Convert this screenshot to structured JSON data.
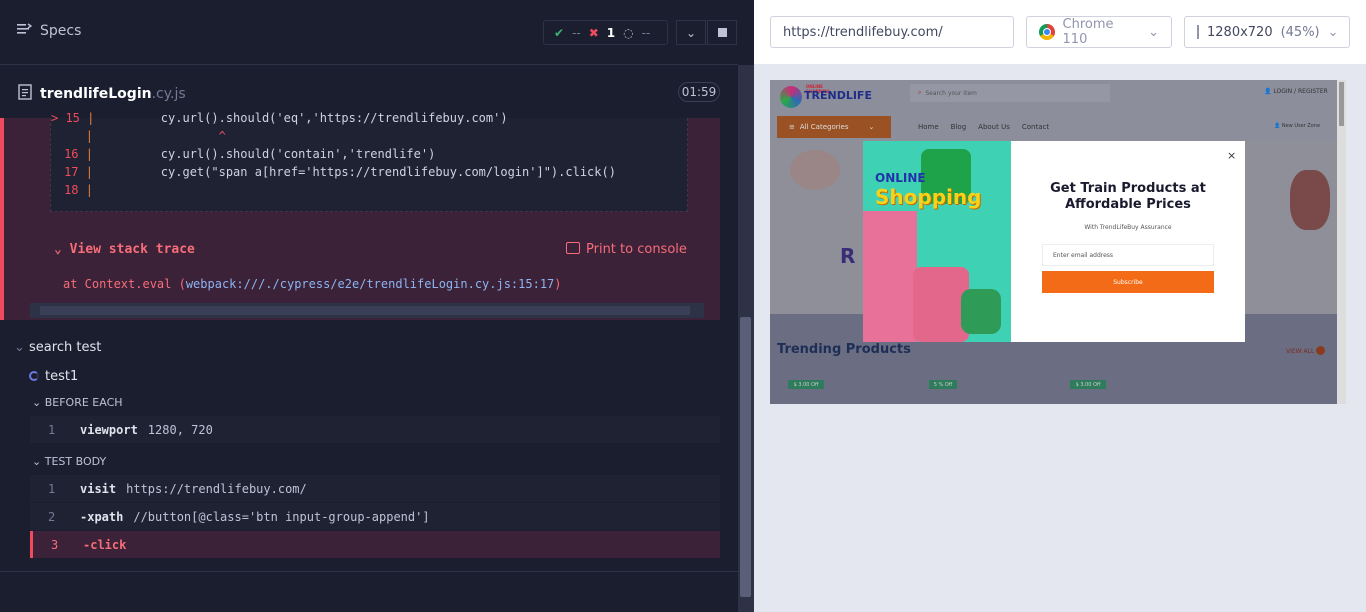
{
  "specs": {
    "title": "Specs",
    "stats": {
      "passed": "--",
      "failed": "1",
      "pending": "--"
    }
  },
  "file": {
    "name": "trendlifeLogin",
    "ext": ".cy.js",
    "duration": "01:59"
  },
  "error": {
    "code_lines": [
      {
        "num": "15",
        "text": "        cy.url().should('eq','https://trendlifebuy.com')"
      },
      {
        "num": "",
        "text": "                ^"
      },
      {
        "num": "16",
        "text": "        cy.url().should('contain','trendlife')"
      },
      {
        "num": "17",
        "text": "        cy.get(\"span a[href='https://trendlifebuy.com/login']\").click()"
      },
      {
        "num": "18",
        "text": ""
      }
    ],
    "view_stack": "View stack trace",
    "print_console": "Print to console",
    "trace_prefix": "at Context.eval (",
    "trace_path": "webpack:///./cypress/e2e/trendlifeLogin.cy.js:15:17",
    "trace_suffix": ")"
  },
  "tree": {
    "suite": "search test",
    "test": "test1",
    "before_each": "BEFORE EACH",
    "test_body": "TEST BODY",
    "before_cmds": [
      {
        "num": "1",
        "name": "viewport",
        "arg": "1280, 720"
      }
    ],
    "body_cmds": [
      {
        "num": "1",
        "name": "visit",
        "arg": "https://trendlifebuy.com/"
      },
      {
        "num": "2",
        "name": "-xpath",
        "arg": "//button[@class='btn input-group-append']"
      },
      {
        "num": "3",
        "name": "-click",
        "arg": ""
      }
    ]
  },
  "browser": {
    "url": "https://trendlifebuy.com/",
    "name": "Chrome 110",
    "viewport": "1280x720",
    "zoom": "(45%)"
  },
  "site": {
    "logo_top": "ONLINE SHOPPING",
    "logo": "TRENDLIFE",
    "search_placeholder": "Search your item",
    "login": "LOGIN / REGISTER",
    "categories": "All Categories",
    "nav": [
      "Home",
      "Blog",
      "About Us",
      "Contact"
    ],
    "new_user": "New User Zone",
    "trending": "Trending Products",
    "view_all": "VIEW ALL",
    "badges": [
      "$ 3.00 Off",
      "5 % Off",
      "$ 3.00 Off"
    ],
    "modal": {
      "online": "ONLINE",
      "shopping": "Shopping",
      "title": "Get Train Products at Affordable Prices",
      "subtitle": "With TrendLifeBuy Assurance",
      "email_placeholder": "Enter email address",
      "subscribe": "Subscribe",
      "close": "×"
    }
  },
  "colors": {
    "fail": "#ef4b5c",
    "pass": "#3cb371",
    "accent": "#f36b16"
  }
}
